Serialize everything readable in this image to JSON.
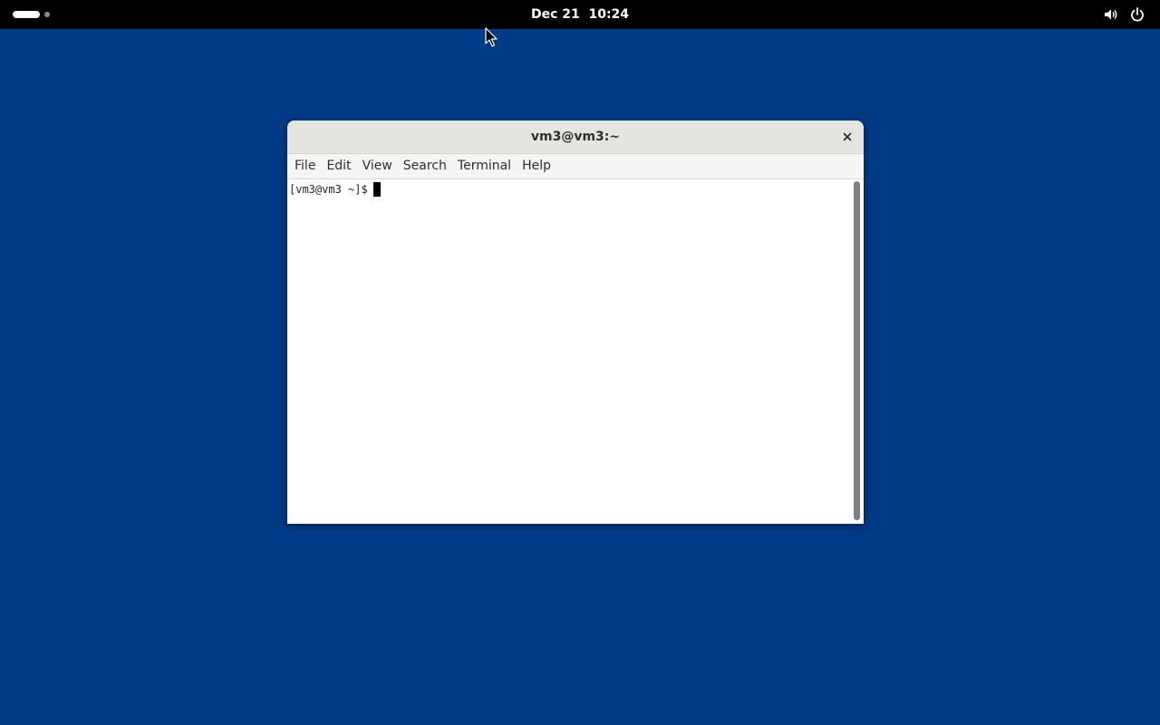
{
  "topbar": {
    "clock": "Dec 21  10:24",
    "icons": [
      "volume-icon",
      "power-icon"
    ]
  },
  "window": {
    "title": "vm3@vm3:~",
    "close_icon": "close-icon",
    "menu": [
      "File",
      "Edit",
      "View",
      "Search",
      "Terminal",
      "Help"
    ],
    "prompt": "[vm3@vm3 ~]$"
  },
  "colors": {
    "desktop": "#003b87",
    "topbar": "#000000",
    "titlebar": "#e6e4e1",
    "terminal_bg": "#ffffff"
  }
}
